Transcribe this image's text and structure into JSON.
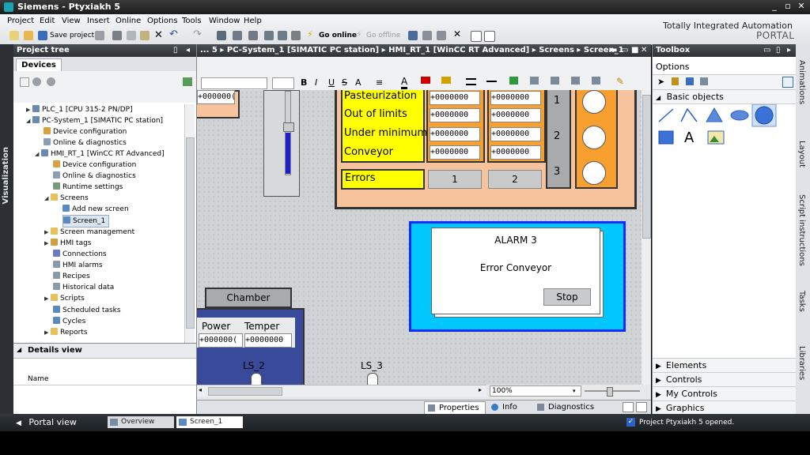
{
  "window": {
    "title": "Siemens - Ptyxiakh 5"
  },
  "menu": [
    "Project",
    "Edit",
    "View",
    "Insert",
    "Online",
    "Options",
    "Tools",
    "Window",
    "Help"
  ],
  "toolbar": {
    "save_project": "Save project",
    "go_online": "Go online",
    "go_offline": "Go offline"
  },
  "brand": {
    "line1": "Totally Integrated Automation",
    "line2": "PORTAL"
  },
  "left_vertical_tab": "Visualization",
  "project_tree": {
    "title": "Project tree",
    "tab": "Devices",
    "items": [
      {
        "label": "PLC_1 [CPU 315-2 PN/DP]"
      },
      {
        "label": "PC-System_1 [SIMATIC PC station]"
      },
      {
        "label": "Device configuration"
      },
      {
        "label": "Online & diagnostics"
      },
      {
        "label": "HMI_RT_1 [WinCC RT Advanced]"
      },
      {
        "label": "Device configuration"
      },
      {
        "label": "Online & diagnostics"
      },
      {
        "label": "Runtime settings"
      },
      {
        "label": "Screens"
      },
      {
        "label": "Add new screen"
      },
      {
        "label": "Screen_1"
      },
      {
        "label": "Screen management"
      },
      {
        "label": "HMI tags"
      },
      {
        "label": "Connections"
      },
      {
        "label": "HMI alarms"
      },
      {
        "label": "Recipes"
      },
      {
        "label": "Historical data"
      },
      {
        "label": "Scripts"
      },
      {
        "label": "Scheduled tasks"
      },
      {
        "label": "Cycles"
      },
      {
        "label": "Reports"
      }
    ]
  },
  "details": {
    "title": "Details view",
    "column": "Name"
  },
  "breadcrumb": "... 5  ▸  PC-System_1 [SIMATIC PC station]  ▸  HMI_RT_1 [WinCC RT Advanced]  ▸  Screens  ▸  Screen_1",
  "screen": {
    "labels": [
      "Pasteurization",
      "Out of limits",
      "Under minimum",
      "Conveyor"
    ],
    "errors_label": "Errors",
    "io_value": "+0000000",
    "io_value_trunc": "+000000(",
    "btn1": "1",
    "btn2": "2",
    "gray_digits": [
      "1",
      "2",
      "3"
    ],
    "chamber": "Chamber",
    "power": "Power",
    "temper": "Temper",
    "ls2": "LS_2",
    "ls3": "LS_3",
    "alarm_title": "ALARM 3",
    "alarm_text": "Error Conveyor",
    "stop": "Stop"
  },
  "zoom": "100%",
  "inspector_tabs": {
    "properties": "Properties",
    "info": "Info",
    "diagnostics": "Diagnostics"
  },
  "toolbox": {
    "title": "Toolbox",
    "options": "Options",
    "basic_objects": "Basic objects",
    "sections": [
      "Elements",
      "Controls",
      "My Controls",
      "Graphics"
    ]
  },
  "right_vertical_tabs": [
    "Animations",
    "Layout",
    "Script instructions",
    "Tasks",
    "Libraries"
  ],
  "statusbar": {
    "portal_view": "Portal view",
    "overview": "Overview",
    "screen_tab": "Screen_1",
    "message": "Project Ptyxiakh 5 opened."
  },
  "colors": {
    "yellow": "#ffff00",
    "salmon": "#f6c39c",
    "orange": "#f7a030",
    "cyan": "#00c8ff",
    "blue": "#0a2cff",
    "navy": "#3a4a9a"
  }
}
